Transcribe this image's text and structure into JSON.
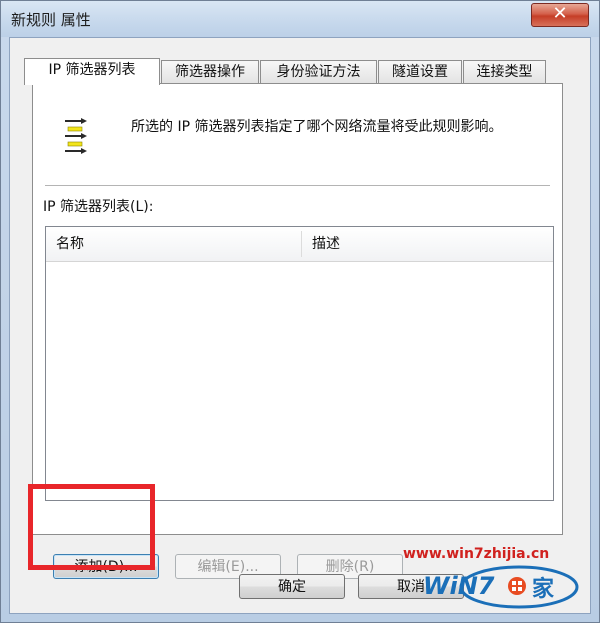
{
  "window": {
    "title": "新规则 属性",
    "close_glyph": "✕"
  },
  "tabs": [
    {
      "label": "IP 筛选器列表",
      "active": true
    },
    {
      "label": "筛选器操作",
      "active": false
    },
    {
      "label": "身份验证方法",
      "active": false
    },
    {
      "label": "隧道设置",
      "active": false
    },
    {
      "label": "连接类型",
      "active": false
    }
  ],
  "panel": {
    "icon": "filter-list-icon",
    "description": "所选的 IP 筛选器列表指定了哪个网络流量将受此规则影响。",
    "list_label": "IP 筛选器列表(L):",
    "columns": [
      "名称",
      "描述"
    ],
    "rows": []
  },
  "buttons": {
    "add": "添加(D)...",
    "edit": "编辑(E)...",
    "delete": "删除(R)",
    "ok": "确定",
    "cancel": "取消"
  },
  "watermark": {
    "url": "www.win7zhijia.cn",
    "logo_text": "WiN7之家"
  },
  "colors": {
    "highlight": "#e8262a",
    "watermark": "#d0211e",
    "accent": "#1b6fb8"
  }
}
